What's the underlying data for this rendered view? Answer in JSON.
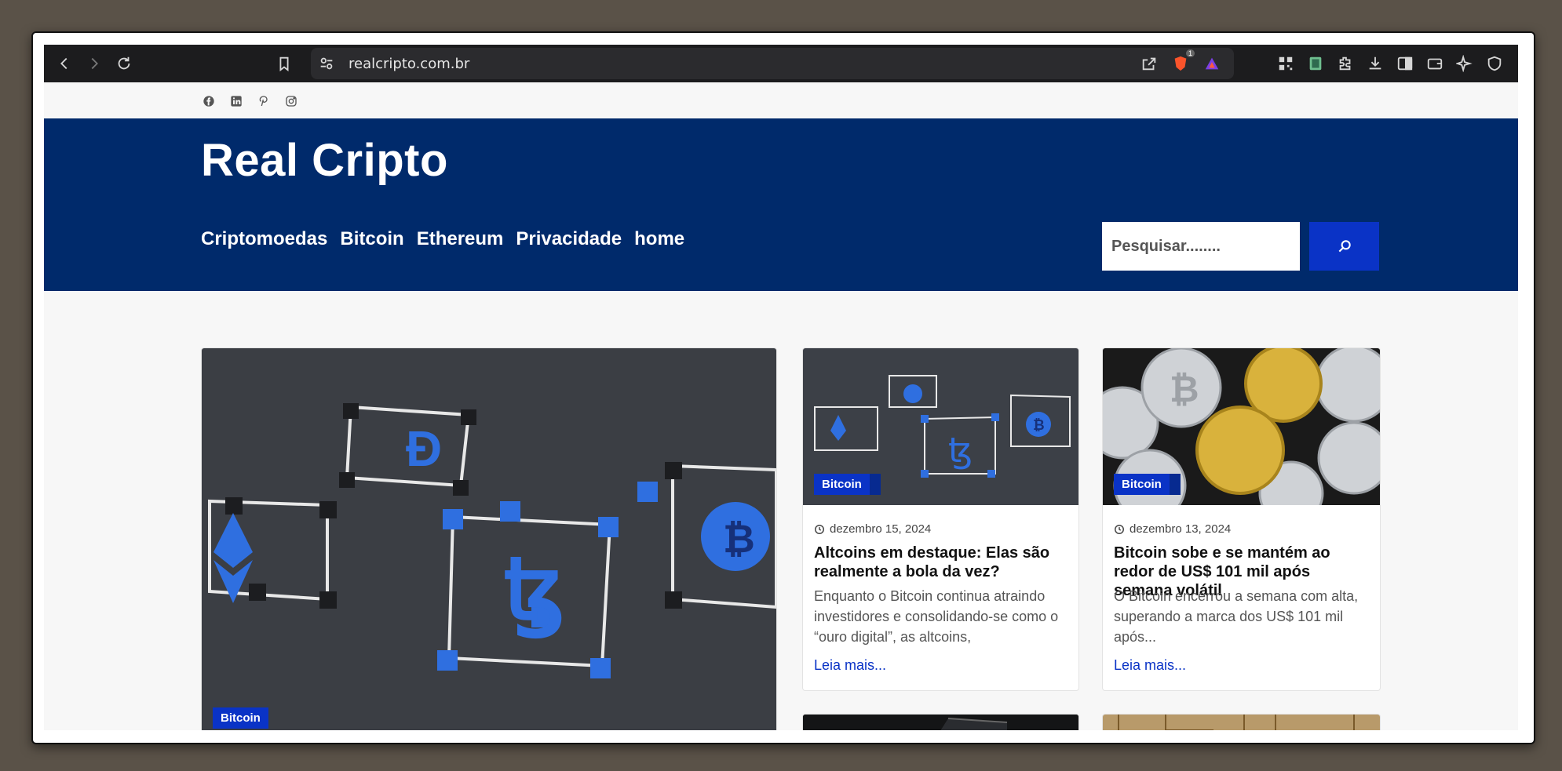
{
  "browser": {
    "url": "realcripto.com.br",
    "brave_badge_count": "1",
    "icons": [
      "back-icon",
      "forward-icon",
      "reload-icon",
      "bookmark-icon",
      "site-settings-icon",
      "share-icon",
      "brave-shield-icon",
      "brave-rewards-icon",
      "qr-code-icon",
      "reader-icon",
      "extensions-icon",
      "downloads-icon",
      "sidebar-icon",
      "wallet-icon",
      "leo-ai-icon",
      "vpn-icon"
    ]
  },
  "social": [
    "facebook-icon",
    "linkedin-icon",
    "pinterest-icon",
    "instagram-icon"
  ],
  "site": {
    "title": "Real Cripto",
    "nav": [
      "Criptomoedas",
      "Bitcoin",
      "Ethereum",
      "Privacidade",
      "home"
    ],
    "search_placeholder": "Pesquisar........"
  },
  "colors": {
    "header_bg": "#002a6b",
    "accent": "#0a33c6"
  },
  "featured": {
    "category": "Bitcoin"
  },
  "posts": [
    {
      "category": "Bitcoin",
      "date": "dezembro 15, 2024",
      "title": "Altcoins em destaque: Elas são realmente a bola da vez?",
      "excerpt": "Enquanto o Bitcoin continua atraindo investidores e consolidando-se como o “ouro digital”, as altcoins, criptomoedas...",
      "more": "Leia mais..."
    },
    {
      "category": "Bitcoin",
      "date": "dezembro 13, 2024",
      "title": "Bitcoin sobe e se mantém ao redor de US$ 101 mil após semana volátil",
      "excerpt": "O Bitcoin encerrou a semana com alta, superando a marca dos US$ 101 mil após...",
      "more": "Leia mais..."
    }
  ]
}
